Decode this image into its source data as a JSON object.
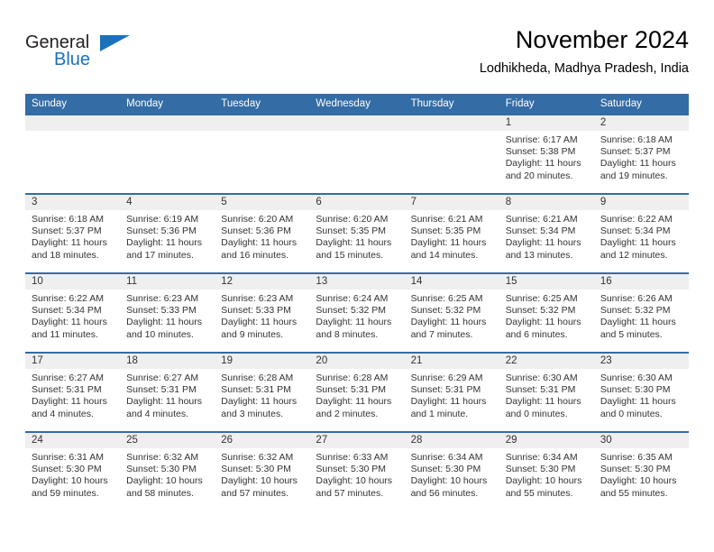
{
  "logo": {
    "word_top": "General",
    "word_bottom": "Blue",
    "color_dark": "#231f20",
    "color_blue": "#1a72bb"
  },
  "header": {
    "title": "November 2024",
    "subtitle": "Lodhikheda, Madhya Pradesh, India"
  },
  "theme": {
    "header_blue": "#346ca5",
    "daynum_band": "#efefef",
    "text": "#333333"
  },
  "weekday_headers": [
    "Sunday",
    "Monday",
    "Tuesday",
    "Wednesday",
    "Thursday",
    "Friday",
    "Saturday"
  ],
  "weeks": [
    [
      {
        "day": "",
        "sunrise": "",
        "sunset": "",
        "daylight_l1": "",
        "daylight_l2": ""
      },
      {
        "day": "",
        "sunrise": "",
        "sunset": "",
        "daylight_l1": "",
        "daylight_l2": ""
      },
      {
        "day": "",
        "sunrise": "",
        "sunset": "",
        "daylight_l1": "",
        "daylight_l2": ""
      },
      {
        "day": "",
        "sunrise": "",
        "sunset": "",
        "daylight_l1": "",
        "daylight_l2": ""
      },
      {
        "day": "",
        "sunrise": "",
        "sunset": "",
        "daylight_l1": "",
        "daylight_l2": ""
      },
      {
        "day": "1",
        "sunrise": "Sunrise: 6:17 AM",
        "sunset": "Sunset: 5:38 PM",
        "daylight_l1": "Daylight: 11 hours",
        "daylight_l2": "and 20 minutes."
      },
      {
        "day": "2",
        "sunrise": "Sunrise: 6:18 AM",
        "sunset": "Sunset: 5:37 PM",
        "daylight_l1": "Daylight: 11 hours",
        "daylight_l2": "and 19 minutes."
      }
    ],
    [
      {
        "day": "3",
        "sunrise": "Sunrise: 6:18 AM",
        "sunset": "Sunset: 5:37 PM",
        "daylight_l1": "Daylight: 11 hours",
        "daylight_l2": "and 18 minutes."
      },
      {
        "day": "4",
        "sunrise": "Sunrise: 6:19 AM",
        "sunset": "Sunset: 5:36 PM",
        "daylight_l1": "Daylight: 11 hours",
        "daylight_l2": "and 17 minutes."
      },
      {
        "day": "5",
        "sunrise": "Sunrise: 6:20 AM",
        "sunset": "Sunset: 5:36 PM",
        "daylight_l1": "Daylight: 11 hours",
        "daylight_l2": "and 16 minutes."
      },
      {
        "day": "6",
        "sunrise": "Sunrise: 6:20 AM",
        "sunset": "Sunset: 5:35 PM",
        "daylight_l1": "Daylight: 11 hours",
        "daylight_l2": "and 15 minutes."
      },
      {
        "day": "7",
        "sunrise": "Sunrise: 6:21 AM",
        "sunset": "Sunset: 5:35 PM",
        "daylight_l1": "Daylight: 11 hours",
        "daylight_l2": "and 14 minutes."
      },
      {
        "day": "8",
        "sunrise": "Sunrise: 6:21 AM",
        "sunset": "Sunset: 5:34 PM",
        "daylight_l1": "Daylight: 11 hours",
        "daylight_l2": "and 13 minutes."
      },
      {
        "day": "9",
        "sunrise": "Sunrise: 6:22 AM",
        "sunset": "Sunset: 5:34 PM",
        "daylight_l1": "Daylight: 11 hours",
        "daylight_l2": "and 12 minutes."
      }
    ],
    [
      {
        "day": "10",
        "sunrise": "Sunrise: 6:22 AM",
        "sunset": "Sunset: 5:34 PM",
        "daylight_l1": "Daylight: 11 hours",
        "daylight_l2": "and 11 minutes."
      },
      {
        "day": "11",
        "sunrise": "Sunrise: 6:23 AM",
        "sunset": "Sunset: 5:33 PM",
        "daylight_l1": "Daylight: 11 hours",
        "daylight_l2": "and 10 minutes."
      },
      {
        "day": "12",
        "sunrise": "Sunrise: 6:23 AM",
        "sunset": "Sunset: 5:33 PM",
        "daylight_l1": "Daylight: 11 hours",
        "daylight_l2": "and 9 minutes."
      },
      {
        "day": "13",
        "sunrise": "Sunrise: 6:24 AM",
        "sunset": "Sunset: 5:32 PM",
        "daylight_l1": "Daylight: 11 hours",
        "daylight_l2": "and 8 minutes."
      },
      {
        "day": "14",
        "sunrise": "Sunrise: 6:25 AM",
        "sunset": "Sunset: 5:32 PM",
        "daylight_l1": "Daylight: 11 hours",
        "daylight_l2": "and 7 minutes."
      },
      {
        "day": "15",
        "sunrise": "Sunrise: 6:25 AM",
        "sunset": "Sunset: 5:32 PM",
        "daylight_l1": "Daylight: 11 hours",
        "daylight_l2": "and 6 minutes."
      },
      {
        "day": "16",
        "sunrise": "Sunrise: 6:26 AM",
        "sunset": "Sunset: 5:32 PM",
        "daylight_l1": "Daylight: 11 hours",
        "daylight_l2": "and 5 minutes."
      }
    ],
    [
      {
        "day": "17",
        "sunrise": "Sunrise: 6:27 AM",
        "sunset": "Sunset: 5:31 PM",
        "daylight_l1": "Daylight: 11 hours",
        "daylight_l2": "and 4 minutes."
      },
      {
        "day": "18",
        "sunrise": "Sunrise: 6:27 AM",
        "sunset": "Sunset: 5:31 PM",
        "daylight_l1": "Daylight: 11 hours",
        "daylight_l2": "and 4 minutes."
      },
      {
        "day": "19",
        "sunrise": "Sunrise: 6:28 AM",
        "sunset": "Sunset: 5:31 PM",
        "daylight_l1": "Daylight: 11 hours",
        "daylight_l2": "and 3 minutes."
      },
      {
        "day": "20",
        "sunrise": "Sunrise: 6:28 AM",
        "sunset": "Sunset: 5:31 PM",
        "daylight_l1": "Daylight: 11 hours",
        "daylight_l2": "and 2 minutes."
      },
      {
        "day": "21",
        "sunrise": "Sunrise: 6:29 AM",
        "sunset": "Sunset: 5:31 PM",
        "daylight_l1": "Daylight: 11 hours",
        "daylight_l2": "and 1 minute."
      },
      {
        "day": "22",
        "sunrise": "Sunrise: 6:30 AM",
        "sunset": "Sunset: 5:31 PM",
        "daylight_l1": "Daylight: 11 hours",
        "daylight_l2": "and 0 minutes."
      },
      {
        "day": "23",
        "sunrise": "Sunrise: 6:30 AM",
        "sunset": "Sunset: 5:30 PM",
        "daylight_l1": "Daylight: 11 hours",
        "daylight_l2": "and 0 minutes."
      }
    ],
    [
      {
        "day": "24",
        "sunrise": "Sunrise: 6:31 AM",
        "sunset": "Sunset: 5:30 PM",
        "daylight_l1": "Daylight: 10 hours",
        "daylight_l2": "and 59 minutes."
      },
      {
        "day": "25",
        "sunrise": "Sunrise: 6:32 AM",
        "sunset": "Sunset: 5:30 PM",
        "daylight_l1": "Daylight: 10 hours",
        "daylight_l2": "and 58 minutes."
      },
      {
        "day": "26",
        "sunrise": "Sunrise: 6:32 AM",
        "sunset": "Sunset: 5:30 PM",
        "daylight_l1": "Daylight: 10 hours",
        "daylight_l2": "and 57 minutes."
      },
      {
        "day": "27",
        "sunrise": "Sunrise: 6:33 AM",
        "sunset": "Sunset: 5:30 PM",
        "daylight_l1": "Daylight: 10 hours",
        "daylight_l2": "and 57 minutes."
      },
      {
        "day": "28",
        "sunrise": "Sunrise: 6:34 AM",
        "sunset": "Sunset: 5:30 PM",
        "daylight_l1": "Daylight: 10 hours",
        "daylight_l2": "and 56 minutes."
      },
      {
        "day": "29",
        "sunrise": "Sunrise: 6:34 AM",
        "sunset": "Sunset: 5:30 PM",
        "daylight_l1": "Daylight: 10 hours",
        "daylight_l2": "and 55 minutes."
      },
      {
        "day": "30",
        "sunrise": "Sunrise: 6:35 AM",
        "sunset": "Sunset: 5:30 PM",
        "daylight_l1": "Daylight: 10 hours",
        "daylight_l2": "and 55 minutes."
      }
    ]
  ]
}
